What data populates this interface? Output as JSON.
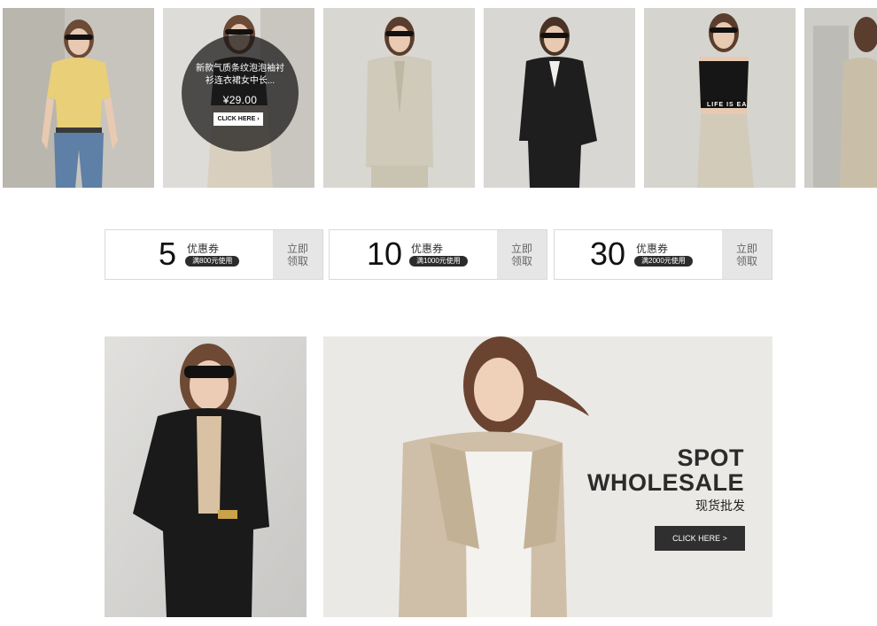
{
  "products": {
    "overlay": {
      "title_line1": "新款气质条纹泡泡袖衬",
      "title_line2": "衫连衣裙女中长...",
      "price": "¥29.00",
      "cta": "CLICK HERE"
    },
    "crop_text": "LIFE IS EA"
  },
  "coupons": [
    {
      "amount": "5",
      "label": "优惠券",
      "condition": "满800元使用",
      "get_line1": "立即",
      "get_line2": "领取"
    },
    {
      "amount": "10",
      "label": "优惠券",
      "condition": "满1000元使用",
      "get_line1": "立即",
      "get_line2": "领取"
    },
    {
      "amount": "30",
      "label": "优惠券",
      "condition": "满2000元使用",
      "get_line1": "立即",
      "get_line2": "领取"
    }
  ],
  "banner": {
    "headline_1": "SPOT",
    "headline_2": "WHOLESALE",
    "subtitle": "现货批发",
    "cta": "CLICK HERE >"
  }
}
